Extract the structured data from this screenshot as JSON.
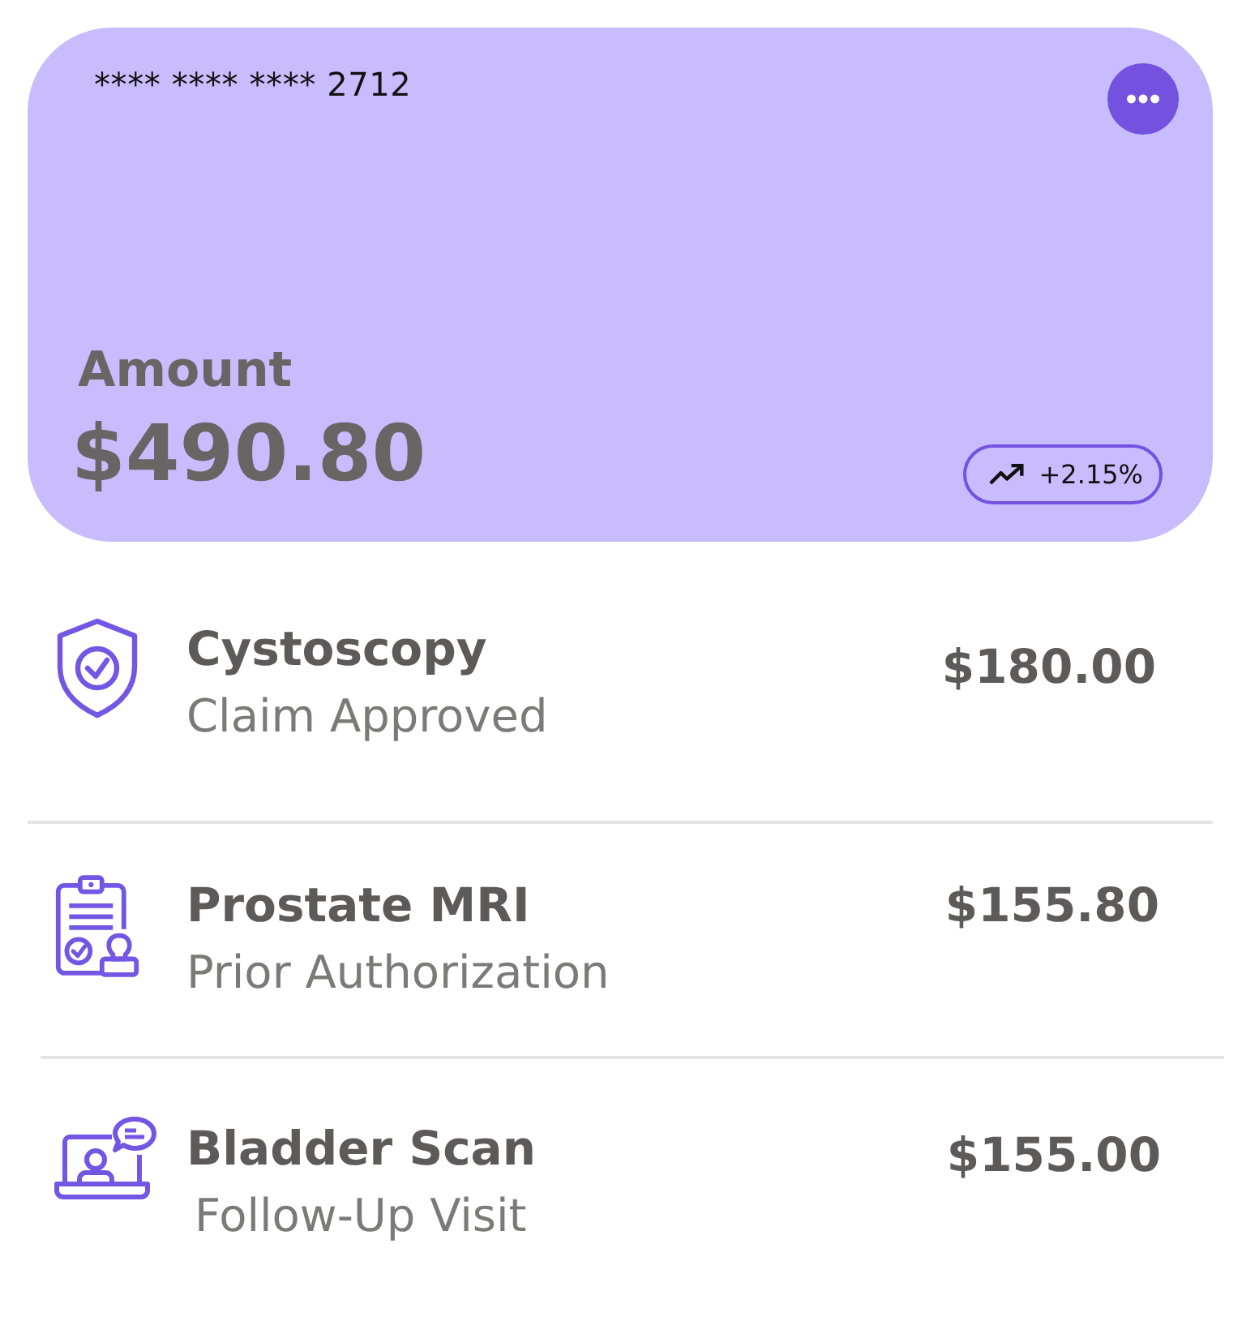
{
  "card": {
    "number": "**** **** **** 2712",
    "label": "Amount",
    "amount": "$490.80",
    "change": "+2.15%"
  },
  "items": [
    {
      "title": "Cystoscopy",
      "subtitle": "Claim Approved",
      "amount": "$180.00"
    },
    {
      "title": "Prostate MRI",
      "subtitle": "Prior Authorization",
      "amount": "$155.80"
    },
    {
      "title": "Bladder Scan",
      "subtitle": "Follow-Up Visit",
      "amount": "$155.00"
    }
  ]
}
